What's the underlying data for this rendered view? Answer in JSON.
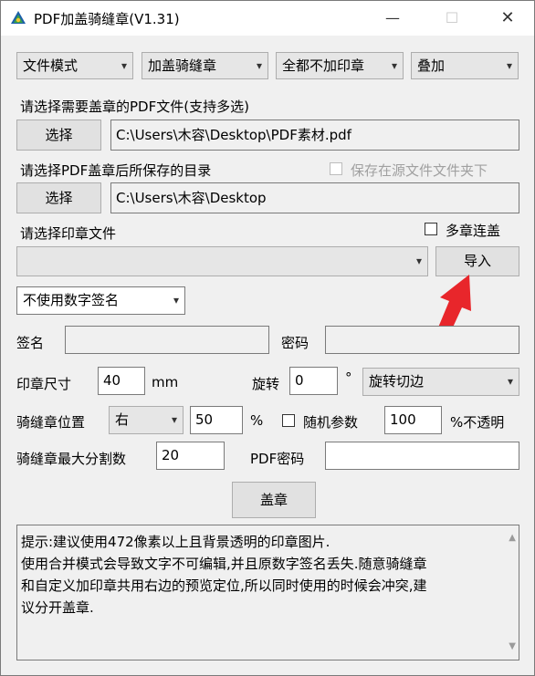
{
  "window": {
    "title": "PDF加盖骑缝章(V1.31)",
    "minimize": "—",
    "maximize": "☐",
    "close": "✕"
  },
  "toolbar": {
    "mode": "文件模式",
    "stamp_type": "加盖骑缝章",
    "stamp_scope": "全都不加印章",
    "overlay": "叠加"
  },
  "pdf_select": {
    "label": "请选择需要盖章的PDF文件(支持多选)",
    "button": "选择",
    "path": "C:\\Users\\木容\\Desktop\\PDF素材.pdf"
  },
  "output_dir": {
    "label": "请选择PDF盖章后所保存的目录",
    "save_in_source_label": "保存在源文件文件夹下",
    "button": "选择",
    "path": "C:\\Users\\木容\\Desktop"
  },
  "stamp_file": {
    "label": "请选择印章文件",
    "multi_label": "多章连盖",
    "import_button": "导入",
    "value": ""
  },
  "signature": {
    "mode": "不使用数字签名",
    "name_label": "签名",
    "name_value": "",
    "password_label": "密码",
    "password_value": ""
  },
  "size": {
    "label": "印章尺寸",
    "value": "40",
    "unit": "mm",
    "rotate_label": "旋转",
    "rotate_value": "0",
    "degree": "°",
    "rotate_mode": "旋转切边"
  },
  "seam": {
    "position_label": "骑缝章位置",
    "position_value": "右",
    "percent_value": "50",
    "percent": "%",
    "random_label": "随机参数",
    "opacity_value": "100",
    "opacity_label": "%不透明",
    "max_split_label": "骑缝章最大分割数",
    "max_split_value": "20",
    "pdf_password_label": "PDF密码",
    "pdf_password_value": ""
  },
  "stamp_button": "盖章",
  "tips": [
    "提示:建议使用472像素以上且背景透明的印章图片.",
    "使用合并模式会导致文字不可编辑,并且原数字签名丢失.随意骑缝章",
    "和自定义加印章共用右边的预览定位,所以同时使用的时候会冲突,建",
    "议分开盖章."
  ],
  "colors": {
    "arrow": "#e8262b",
    "accent": "#0078d7"
  }
}
